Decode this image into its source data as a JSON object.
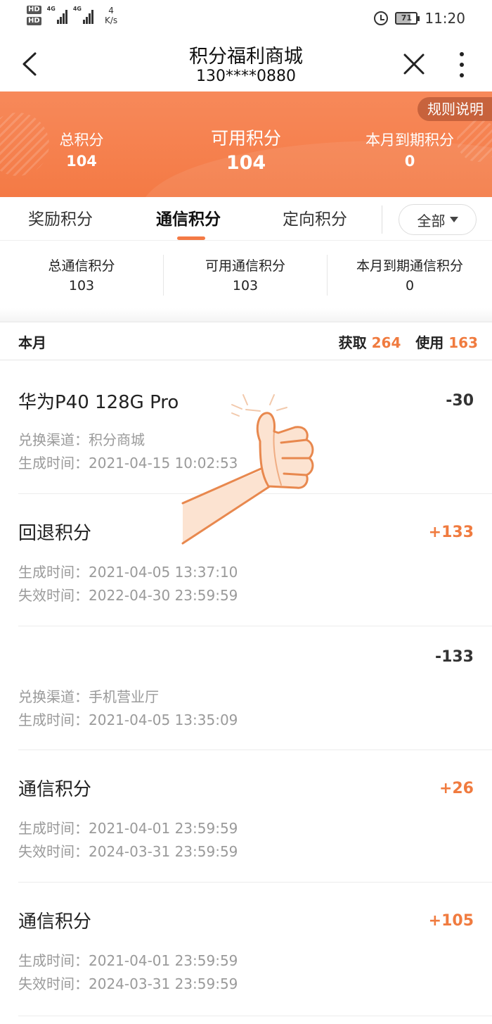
{
  "status_bar": {
    "hd_top": "HD",
    "hd_bottom": "HD",
    "net1": "4G",
    "net2": "4G",
    "speed_value": "4",
    "speed_unit": "K/s",
    "battery": "71",
    "time": "11:20"
  },
  "nav": {
    "title": "积分福利商城",
    "subtitle": "130****0880"
  },
  "banner": {
    "rules_label": "规则说明",
    "total_label": "总积分",
    "total_value": "104",
    "available_label": "可用积分",
    "available_value": "104",
    "expiring_label": "本月到期积分",
    "expiring_value": "0",
    "accent_color": "#f47a45"
  },
  "tabs": {
    "items": [
      "奖励积分",
      "通信积分",
      "定向积分"
    ],
    "active_index": 1,
    "filter_label": "全部"
  },
  "sub_stats": {
    "total_label": "总通信积分",
    "total_value": "103",
    "available_label": "可用通信积分",
    "available_value": "103",
    "expiring_label": "本月到期通信积分",
    "expiring_value": "0"
  },
  "month": {
    "label": "本月",
    "earn_label": "获取",
    "earn_value": "264",
    "use_label": "使用",
    "use_value": "163"
  },
  "records": [
    {
      "title": "华为P40 128G Pro",
      "amount": "-30",
      "line1": "兑换渠道：积分商城",
      "line2": "生成时间：2021-04-15 10:02:53"
    },
    {
      "title": "回退积分",
      "amount": "+133",
      "line1": "生成时间：2021-04-05 13:37:10",
      "line2": "失效时间：2022-04-30 23:59:59"
    },
    {
      "title": "",
      "amount": "-133",
      "line1": "兑换渠道：手机营业厅",
      "line2": "生成时间：2021-04-05 13:35:09"
    },
    {
      "title": "通信积分",
      "amount": "+26",
      "line1": "生成时间：2021-04-01 23:59:59",
      "line2": "失效时间：2024-03-31 23:59:59"
    },
    {
      "title": "通信积分",
      "amount": "+105",
      "line1": "生成时间：2021-04-01 23:59:59",
      "line2": "失效时间：2024-03-31 23:59:59"
    }
  ],
  "icons": {
    "back": "chevron-left-icon",
    "close": "close-icon",
    "more": "more-vertical-icon",
    "filter_caret": "caret-down-icon",
    "overlay": "thumbs-up-icon"
  }
}
